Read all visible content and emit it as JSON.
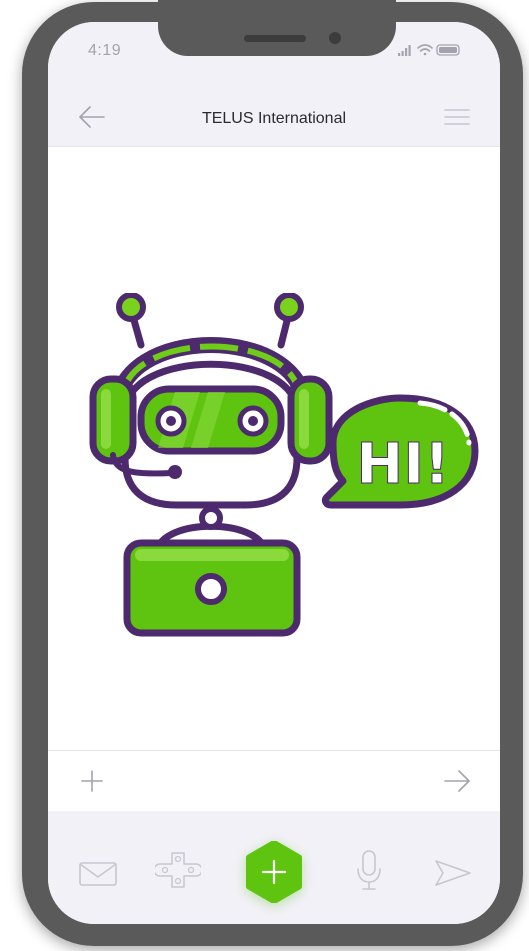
{
  "status_bar": {
    "time": "4:19",
    "signal_icon": "signal-icon",
    "wifi_icon": "wifi-icon",
    "battery_icon": "battery-icon"
  },
  "header": {
    "title": "TELUS International",
    "back_icon": "arrow-left-icon",
    "menu_icon": "hamburger-menu-icon"
  },
  "chat": {
    "speech_bubble_text": "HI!"
  },
  "input_bar": {
    "add_icon": "plus-icon",
    "send_icon": "arrow-right-icon"
  },
  "bottom_bar": {
    "items": [
      "mail-icon",
      "gamepad-icon",
      "add-fab-icon",
      "microphone-icon",
      "send-icon"
    ]
  },
  "colors": {
    "accent_green": "#5ec40f",
    "robot_purple": "#4c2a6d",
    "header_bg": "#f3f1f8",
    "phone_frame": "#5a5a5a"
  }
}
